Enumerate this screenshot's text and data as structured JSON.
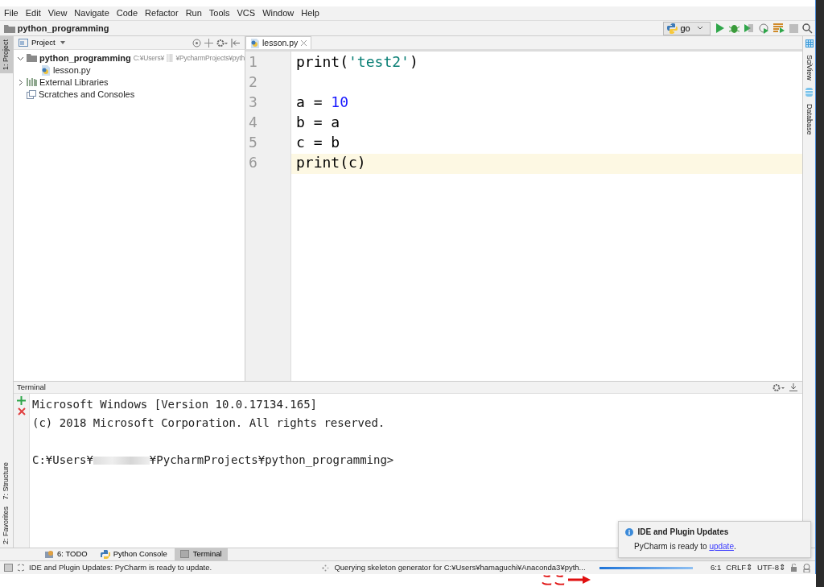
{
  "menu": [
    "File",
    "Edit",
    "View",
    "Navigate",
    "Code",
    "Refactor",
    "Run",
    "Tools",
    "VCS",
    "Window",
    "Help"
  ],
  "breadcrumb": "python_programming",
  "run_config": "go",
  "left_tool_tabs": [
    {
      "label": "1: Project",
      "selected": true,
      "kind": "top"
    },
    {
      "label": "7: Structure",
      "selected": false,
      "kind": "bottom"
    },
    {
      "label": "2: Favorites",
      "selected": false,
      "kind": "bottom"
    }
  ],
  "right_tool_tabs": [
    {
      "label": "SciView"
    },
    {
      "label": "Database"
    }
  ],
  "project_panel": {
    "title": "Project",
    "tree": [
      {
        "label": "python_programming",
        "kind": "folder",
        "expanded": true,
        "path_start": "C:¥Users¥",
        "path_end": "¥PycharmProjects¥pyth",
        "children": [
          {
            "label": "lesson.py",
            "kind": "file"
          }
        ]
      },
      {
        "label": "External Libraries",
        "kind": "library",
        "expanded": false
      },
      {
        "label": "Scratches and Consoles",
        "kind": "scratch"
      }
    ]
  },
  "editor": {
    "tabs": [
      {
        "label": "lesson.py",
        "selected": true
      }
    ],
    "lines": [
      {
        "number": "1",
        "current": false,
        "tokens": [
          {
            "text": "print(",
            "kind": "plain"
          },
          {
            "text": "'test2'",
            "kind": "string"
          },
          {
            "text": ")",
            "kind": "plain"
          }
        ]
      },
      {
        "number": "2",
        "current": false
      },
      {
        "number": "3",
        "current": false,
        "tokens": [
          {
            "text": "a = ",
            "kind": "plain"
          },
          {
            "text": "10",
            "kind": "number"
          }
        ]
      },
      {
        "number": "4",
        "current": false,
        "tokens": [
          {
            "text": "b = a",
            "kind": "plain"
          }
        ]
      },
      {
        "number": "5",
        "current": false,
        "tokens": [
          {
            "text": "c = b",
            "kind": "plain"
          }
        ]
      },
      {
        "number": "6",
        "current": true,
        "tokens": [
          {
            "text": "print(c)",
            "kind": "plain"
          }
        ]
      }
    ]
  },
  "terminal": {
    "title": "Terminal",
    "output": [
      "Microsoft Windows [Version 10.0.17134.165]",
      "(c) 2018 Microsoft Corporation. All rights reserved."
    ],
    "prompt": {
      "start": "C:¥Users¥",
      "end": "¥PycharmProjects¥python_programming>"
    }
  },
  "bottom_tabs": [
    {
      "label": "6: TODO",
      "selected": false,
      "kind": "todo"
    },
    {
      "label": "Python Console",
      "selected": false,
      "kind": "console"
    },
    {
      "label": "Terminal",
      "selected": true,
      "kind": "terminal"
    }
  ],
  "status_bar": {
    "message": "IDE and Plugin Updates: PyCharm is ready to update.",
    "task": "Querying skeleton generator for C:¥Users¥hamaguchi¥Anaconda3¥pyth...",
    "progress": {
      "level": 1
    },
    "position": "6:1",
    "line_separator": "CRLF⇕",
    "encoding": "UTF-8⇕"
  },
  "notification": {
    "title": "IDE and Plugin Updates",
    "message_before": "PyCharm is ready to ",
    "link": "update",
    "message_after": "."
  },
  "annotation": {
    "text": "ここ"
  }
}
